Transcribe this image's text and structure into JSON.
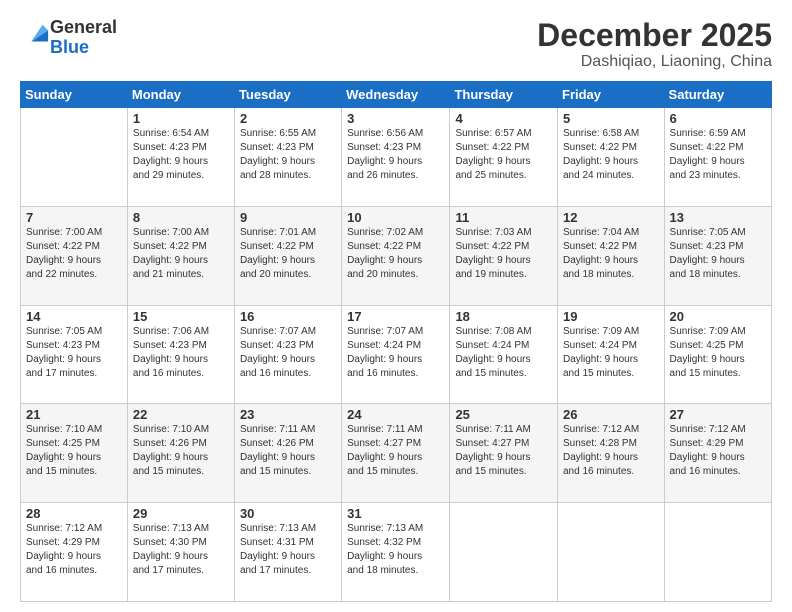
{
  "header": {
    "logo_general": "General",
    "logo_blue": "Blue",
    "title": "December 2025",
    "subtitle": "Dashiqiao, Liaoning, China"
  },
  "calendar": {
    "days_of_week": [
      "Sunday",
      "Monday",
      "Tuesday",
      "Wednesday",
      "Thursday",
      "Friday",
      "Saturday"
    ],
    "weeks": [
      [
        {
          "day": "",
          "info": ""
        },
        {
          "day": "1",
          "info": "Sunrise: 6:54 AM\nSunset: 4:23 PM\nDaylight: 9 hours\nand 29 minutes."
        },
        {
          "day": "2",
          "info": "Sunrise: 6:55 AM\nSunset: 4:23 PM\nDaylight: 9 hours\nand 28 minutes."
        },
        {
          "day": "3",
          "info": "Sunrise: 6:56 AM\nSunset: 4:23 PM\nDaylight: 9 hours\nand 26 minutes."
        },
        {
          "day": "4",
          "info": "Sunrise: 6:57 AM\nSunset: 4:22 PM\nDaylight: 9 hours\nand 25 minutes."
        },
        {
          "day": "5",
          "info": "Sunrise: 6:58 AM\nSunset: 4:22 PM\nDaylight: 9 hours\nand 24 minutes."
        },
        {
          "day": "6",
          "info": "Sunrise: 6:59 AM\nSunset: 4:22 PM\nDaylight: 9 hours\nand 23 minutes."
        }
      ],
      [
        {
          "day": "7",
          "info": "Sunrise: 7:00 AM\nSunset: 4:22 PM\nDaylight: 9 hours\nand 22 minutes."
        },
        {
          "day": "8",
          "info": "Sunrise: 7:00 AM\nSunset: 4:22 PM\nDaylight: 9 hours\nand 21 minutes."
        },
        {
          "day": "9",
          "info": "Sunrise: 7:01 AM\nSunset: 4:22 PM\nDaylight: 9 hours\nand 20 minutes."
        },
        {
          "day": "10",
          "info": "Sunrise: 7:02 AM\nSunset: 4:22 PM\nDaylight: 9 hours\nand 20 minutes."
        },
        {
          "day": "11",
          "info": "Sunrise: 7:03 AM\nSunset: 4:22 PM\nDaylight: 9 hours\nand 19 minutes."
        },
        {
          "day": "12",
          "info": "Sunrise: 7:04 AM\nSunset: 4:22 PM\nDaylight: 9 hours\nand 18 minutes."
        },
        {
          "day": "13",
          "info": "Sunrise: 7:05 AM\nSunset: 4:23 PM\nDaylight: 9 hours\nand 18 minutes."
        }
      ],
      [
        {
          "day": "14",
          "info": "Sunrise: 7:05 AM\nSunset: 4:23 PM\nDaylight: 9 hours\nand 17 minutes."
        },
        {
          "day": "15",
          "info": "Sunrise: 7:06 AM\nSunset: 4:23 PM\nDaylight: 9 hours\nand 16 minutes."
        },
        {
          "day": "16",
          "info": "Sunrise: 7:07 AM\nSunset: 4:23 PM\nDaylight: 9 hours\nand 16 minutes."
        },
        {
          "day": "17",
          "info": "Sunrise: 7:07 AM\nSunset: 4:24 PM\nDaylight: 9 hours\nand 16 minutes."
        },
        {
          "day": "18",
          "info": "Sunrise: 7:08 AM\nSunset: 4:24 PM\nDaylight: 9 hours\nand 15 minutes."
        },
        {
          "day": "19",
          "info": "Sunrise: 7:09 AM\nSunset: 4:24 PM\nDaylight: 9 hours\nand 15 minutes."
        },
        {
          "day": "20",
          "info": "Sunrise: 7:09 AM\nSunset: 4:25 PM\nDaylight: 9 hours\nand 15 minutes."
        }
      ],
      [
        {
          "day": "21",
          "info": "Sunrise: 7:10 AM\nSunset: 4:25 PM\nDaylight: 9 hours\nand 15 minutes."
        },
        {
          "day": "22",
          "info": "Sunrise: 7:10 AM\nSunset: 4:26 PM\nDaylight: 9 hours\nand 15 minutes."
        },
        {
          "day": "23",
          "info": "Sunrise: 7:11 AM\nSunset: 4:26 PM\nDaylight: 9 hours\nand 15 minutes."
        },
        {
          "day": "24",
          "info": "Sunrise: 7:11 AM\nSunset: 4:27 PM\nDaylight: 9 hours\nand 15 minutes."
        },
        {
          "day": "25",
          "info": "Sunrise: 7:11 AM\nSunset: 4:27 PM\nDaylight: 9 hours\nand 15 minutes."
        },
        {
          "day": "26",
          "info": "Sunrise: 7:12 AM\nSunset: 4:28 PM\nDaylight: 9 hours\nand 16 minutes."
        },
        {
          "day": "27",
          "info": "Sunrise: 7:12 AM\nSunset: 4:29 PM\nDaylight: 9 hours\nand 16 minutes."
        }
      ],
      [
        {
          "day": "28",
          "info": "Sunrise: 7:12 AM\nSunset: 4:29 PM\nDaylight: 9 hours\nand 16 minutes."
        },
        {
          "day": "29",
          "info": "Sunrise: 7:13 AM\nSunset: 4:30 PM\nDaylight: 9 hours\nand 17 minutes."
        },
        {
          "day": "30",
          "info": "Sunrise: 7:13 AM\nSunset: 4:31 PM\nDaylight: 9 hours\nand 17 minutes."
        },
        {
          "day": "31",
          "info": "Sunrise: 7:13 AM\nSunset: 4:32 PM\nDaylight: 9 hours\nand 18 minutes."
        },
        {
          "day": "",
          "info": ""
        },
        {
          "day": "",
          "info": ""
        },
        {
          "day": "",
          "info": ""
        }
      ]
    ]
  }
}
